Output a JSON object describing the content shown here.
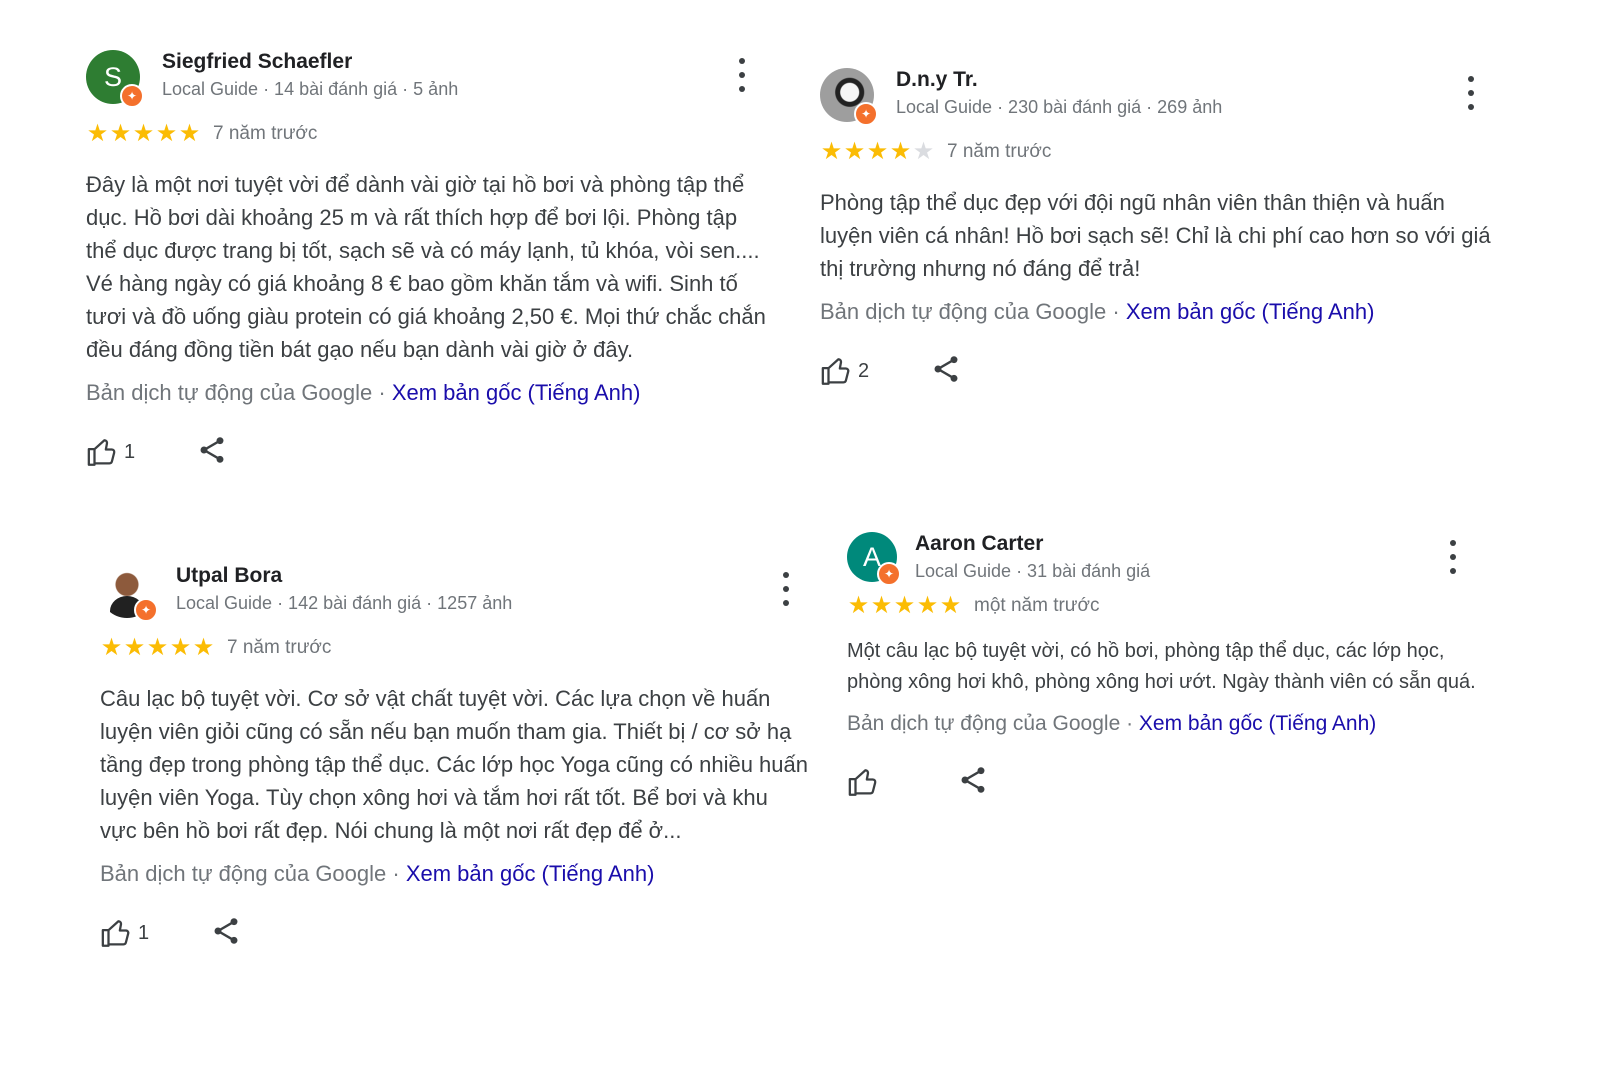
{
  "reviews": [
    {
      "avatar_letter": "S",
      "avatar_color": "#2e7d32",
      "name": "Siegfried Schaefler",
      "meta": "Local Guide · 14 bài đánh giá · 5 ảnh",
      "stars": 5,
      "when": "7 năm trước",
      "text": "Đây là một nơi tuyệt vời để dành vài giờ tại hồ bơi và phòng tập thể dục. Hồ bơi dài khoảng 25 m và rất thích hợp để bơi lội. Phòng tập thể dục được trang bị tốt, sạch sẽ và có máy lạnh, tủ khóa, vòi sen.... Vé hàng ngày có giá khoảng 8 € bao gồm khăn tắm và wifi. Sinh tố tươi và đồ uống giàu protein có giá khoảng 2,50 €. Mọi thứ chắc chắn đều đáng đồng tiền bát gạo nếu bạn dành vài giờ ở đây.",
      "translated_note": "Bản dịch tự động của Google · ",
      "original_link": "Xem bản gốc (Tiếng Anh)",
      "likes": "1"
    },
    {
      "avatar_letter": "",
      "avatar_color": "#5f6368",
      "name": "D.n.y Tr.",
      "meta": "Local Guide · 230 bài đánh giá · 269 ảnh",
      "stars": 4,
      "when": "7 năm trước",
      "text": "Phòng tập thể dục đẹp với đội ngũ nhân viên thân thiện và huấn luyện viên cá nhân! Hồ bơi sạch sẽ! Chỉ là chi phí cao hơn so với giá thị trường nhưng nó đáng để trả!",
      "translated_note": "Bản dịch tự động của Google · ",
      "original_link": "Xem bản gốc (Tiếng Anh)",
      "likes": "2"
    },
    {
      "avatar_letter": "",
      "avatar_color": "#6d4c41",
      "name": "Utpal Bora",
      "meta": "Local Guide · 142 bài đánh giá · 1257 ảnh",
      "stars": 5,
      "when": "7 năm trước",
      "text": "Câu lạc bộ tuyệt vời. Cơ sở vật chất tuyệt vời. Các lựa chọn về huấn luyện viên giỏi cũng có sẵn nếu bạn muốn tham gia. Thiết bị / cơ sở hạ tầng đẹp trong phòng tập thể dục. Các lớp học Yoga cũng có nhiều huấn luyện viên Yoga. Tùy chọn xông hơi và tắm hơi rất tốt. Bể bơi và khu vực bên hồ bơi rất đẹp. Nói chung là một nơi rất đẹp để ở...",
      "translated_note": "Bản dịch tự động của Google · ",
      "original_link": "Xem bản gốc (Tiếng Anh)",
      "likes": "1"
    },
    {
      "avatar_letter": "A",
      "avatar_color": "#00897b",
      "name": "Aaron Carter",
      "meta": "Local Guide · 31 bài đánh giá",
      "stars": 5,
      "when": "một năm trước",
      "text": "Một câu lạc bộ tuyệt vời, có hồ bơi, phòng tập thể dục, các lớp học, phòng xông hơi khô, phòng xông hơi ướt. Ngày thành viên có sẵn quá.",
      "translated_note": "Bản dịch tự động của Google · ",
      "original_link": "Xem bản gốc (Tiếng Anh)",
      "likes": ""
    }
  ],
  "icons": {
    "star": "★",
    "badge": "✦",
    "like": "thumbs-up-icon",
    "share": "share-icon",
    "more": "more-vert-icon"
  },
  "colors": {
    "star": "#fbbc04",
    "link": "#1a0dab",
    "badge": "#f4702c"
  }
}
